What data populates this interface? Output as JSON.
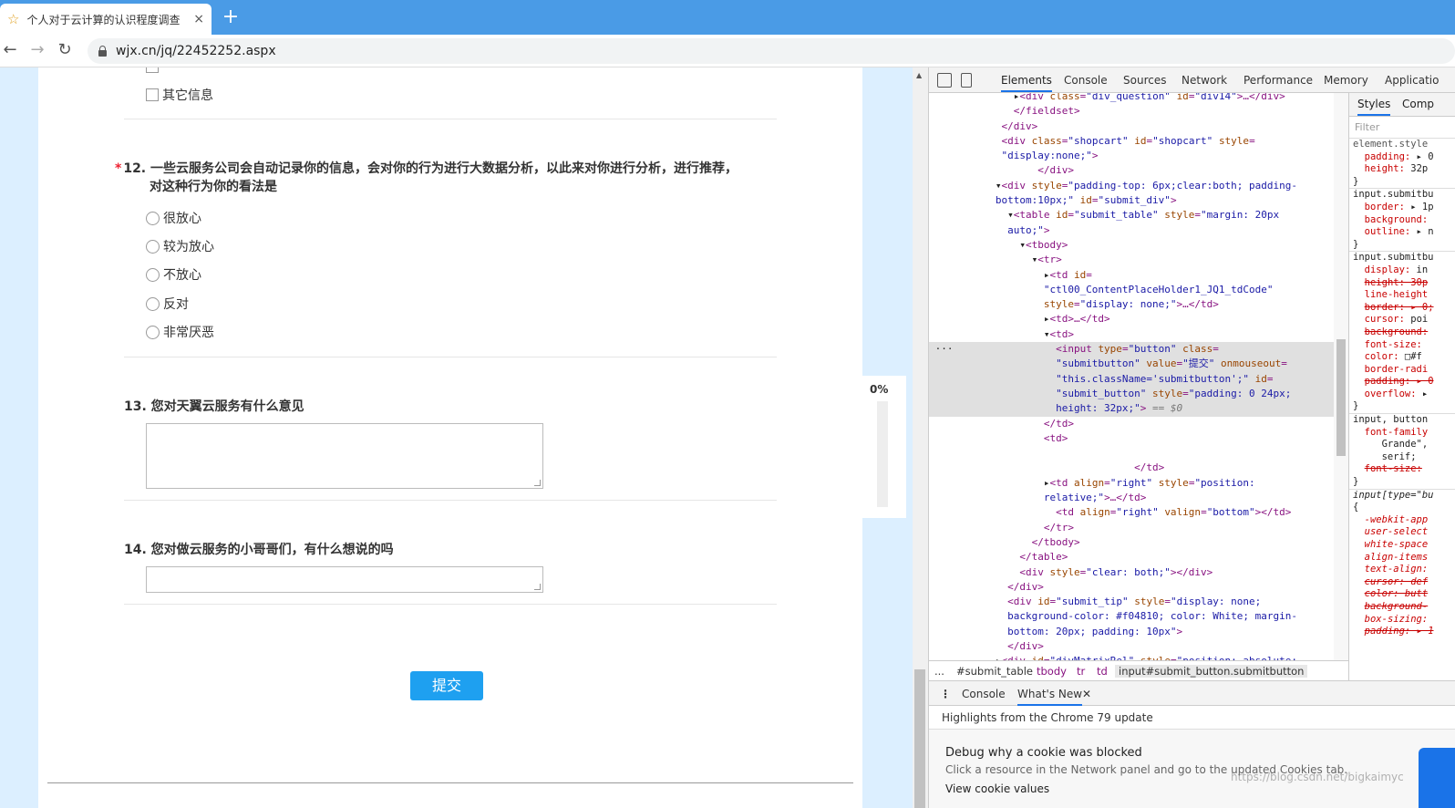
{
  "browser": {
    "tab_title": "个人对于云计算的认识程度调查",
    "new_tab": "+",
    "close": "×",
    "url": "wjx.cn/jq/22452252.aspx"
  },
  "survey": {
    "q11_partial_option": "其它信息",
    "q12": {
      "star": "*",
      "title": "12. 一些云服务公司会自动记录你的信息，会对你的行为进行大数据分析，以此来对你进行分析，进行推荐，",
      "title_line2": "对这种行为你的看法是",
      "options": [
        "很放心",
        "较为放心",
        "不放心",
        "反对",
        "非常厌恶"
      ]
    },
    "q13": {
      "title": "13. 您对天翼云服务有什么意见"
    },
    "q14": {
      "title": "14. 您对做云服务的小哥哥们，有什么想说的吗"
    },
    "submit_label": "提交",
    "progress_pct": "0%"
  },
  "devtools": {
    "tabs": [
      "Elements",
      "Console",
      "Sources",
      "Network",
      "Performance",
      "Memory",
      "Applicatio"
    ],
    "style_tabs": [
      "Styles",
      "Comp"
    ],
    "filter_placeholder": "Filter",
    "breadcrumbs": [
      "...",
      "#submit_table",
      "tbody",
      "tr",
      "td",
      "input#submit_button.submitbutton"
    ],
    "drawer_tabs": [
      "Console",
      "What's New"
    ],
    "whats_new_head": "Highlights from the Chrome 79 update",
    "whats_new_item_title": "Debug why a cookie was blocked",
    "whats_new_item_desc": "Click a resource in the Network panel and go to the updated Cookies tab.",
    "whats_new_item_cut": "View cookie values"
  },
  "watermark": "https://blog.csdn.net/bigkaimyc"
}
